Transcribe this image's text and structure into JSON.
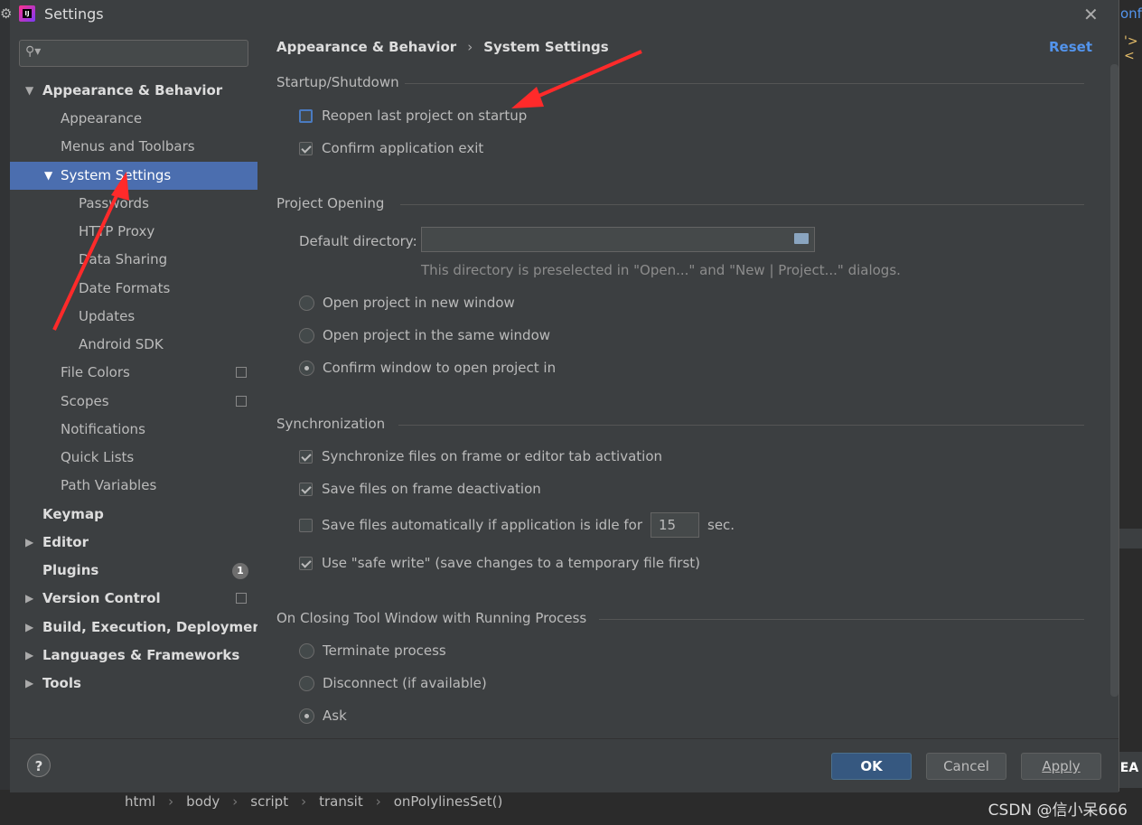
{
  "window": {
    "title": "Settings"
  },
  "search": {
    "placeholder": ""
  },
  "sidebar": {
    "items": [
      {
        "label": "Appearance & Behavior",
        "level": 0,
        "bold": true,
        "expanded": true
      },
      {
        "label": "Appearance",
        "level": 1
      },
      {
        "label": "Menus and Toolbars",
        "level": 1
      },
      {
        "label": "System Settings",
        "level": 1,
        "expanded": true,
        "selected": true
      },
      {
        "label": "Passwords",
        "level": 2
      },
      {
        "label": "HTTP Proxy",
        "level": 2
      },
      {
        "label": "Data Sharing",
        "level": 2
      },
      {
        "label": "Date Formats",
        "level": 2
      },
      {
        "label": "Updates",
        "level": 2
      },
      {
        "label": "Android SDK",
        "level": 2
      },
      {
        "label": "File Colors",
        "level": 1,
        "copy": true
      },
      {
        "label": "Scopes",
        "level": 1,
        "copy": true
      },
      {
        "label": "Notifications",
        "level": 1
      },
      {
        "label": "Quick Lists",
        "level": 1
      },
      {
        "label": "Path Variables",
        "level": 1
      },
      {
        "label": "Keymap",
        "level": 0,
        "bold": true
      },
      {
        "label": "Editor",
        "level": 0,
        "bold": true,
        "collapsed": true
      },
      {
        "label": "Plugins",
        "level": 0,
        "bold": true,
        "badge": "1"
      },
      {
        "label": "Version Control",
        "level": 0,
        "bold": true,
        "collapsed": true,
        "copy": true
      },
      {
        "label": "Build, Execution, Deployment",
        "level": 0,
        "bold": true,
        "collapsed": true
      },
      {
        "label": "Languages & Frameworks",
        "level": 0,
        "bold": true,
        "collapsed": true
      },
      {
        "label": "Tools",
        "level": 0,
        "bold": true,
        "collapsed": true
      }
    ]
  },
  "content": {
    "breadcrumb": {
      "parent": "Appearance & Behavior",
      "current": "System Settings"
    },
    "reset": "Reset",
    "startup": {
      "title": "Startup/Shutdown",
      "reopen": "Reopen last project on startup",
      "confirm_exit": "Confirm application exit"
    },
    "project_opening": {
      "title": "Project Opening",
      "dir_label": "Default directory:",
      "dir_value": "",
      "hint": "This directory is preselected in \"Open...\" and \"New | Project...\" dialogs.",
      "opt_new": "Open project in new window",
      "opt_same": "Open project in the same window",
      "opt_confirm": "Confirm window to open project in"
    },
    "sync": {
      "title": "Synchronization",
      "sync_files": "Synchronize files on frame or editor tab activation",
      "save_deactivation": "Save files on frame deactivation",
      "save_idle": "Save files automatically if application is idle for",
      "idle_value": "15",
      "idle_unit": "sec.",
      "safe_write": "Use \"safe write\" (save changes to a temporary file first)"
    },
    "closing": {
      "title": "On Closing Tool Window with Running Process",
      "terminate": "Terminate process",
      "disconnect": "Disconnect (if available)",
      "ask": "Ask"
    }
  },
  "footer": {
    "help": "?",
    "ok": "OK",
    "cancel": "Cancel",
    "apply": "Apply"
  },
  "background": {
    "right_text_top": "onf",
    "right_text_code": "'><",
    "right_panel_text": "EA",
    "breadcrumb": [
      "html",
      "body",
      "script",
      "transit",
      "onPolylinesSet()"
    ],
    "watermark": "CSDN @信小呆666"
  },
  "colors": {
    "selection": "#4b6eaf",
    "link": "#5394ec",
    "ok_button": "#365880",
    "annotation": "#ff2a2a"
  }
}
